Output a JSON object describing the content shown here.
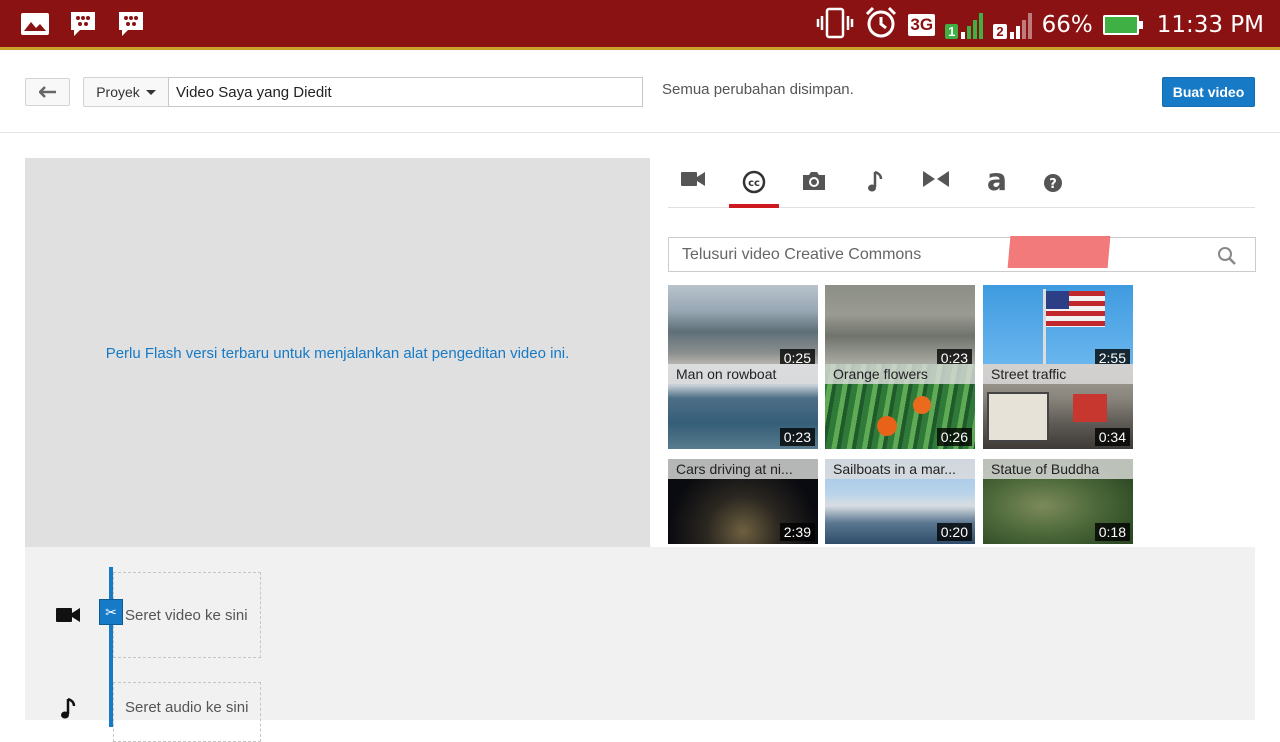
{
  "status_bar": {
    "network": "3G",
    "signal_1_label": "1",
    "signal_2_label": "2",
    "battery": "66%",
    "time": "11:33 PM",
    "icons": [
      "gallery-icon",
      "bbm-icon",
      "bbm-icon",
      "vibrate-icon",
      "alarm-icon",
      "signal-icon",
      "battery-icon"
    ]
  },
  "toolbar": {
    "project_label": "Proyek",
    "title_value": "Video Saya yang Diedit",
    "saved_status": "Semua perubahan disimpan.",
    "create_label": "Buat video"
  },
  "preview": {
    "message": "Perlu Flash versi terbaru untuk menjalankan alat pengeditan video ini."
  },
  "tabs": [
    {
      "icon": "video-camera-icon",
      "active": false
    },
    {
      "icon": "creative-commons-icon",
      "active": true
    },
    {
      "icon": "photo-camera-icon",
      "active": false
    },
    {
      "icon": "music-note-icon",
      "active": false
    },
    {
      "icon": "transitions-icon",
      "active": false
    },
    {
      "icon": "text-icon",
      "active": false
    },
    {
      "icon": "help-icon",
      "active": false
    }
  ],
  "search": {
    "placeholder": "Telusuri video Creative Commons"
  },
  "videos": [
    {
      "title": "",
      "duration": "0:25"
    },
    {
      "title": "",
      "duration": "0:23"
    },
    {
      "title": "",
      "duration": "2:55"
    },
    {
      "title": "Man on rowboat",
      "duration": "0:23"
    },
    {
      "title": "Orange flowers",
      "duration": "0:26"
    },
    {
      "title": "Street traffic",
      "duration": "0:34"
    },
    {
      "title": "Cars driving at ni...",
      "duration": "2:39"
    },
    {
      "title": "Sailboats in a mar...",
      "duration": "0:20"
    },
    {
      "title": "Statue of Buddha",
      "duration": "0:18"
    }
  ],
  "timeline": {
    "video_drop": "Seret video ke sini",
    "audio_drop": "Seret audio ke sini"
  },
  "colors": {
    "status_bar": "#8b1212",
    "accent_blue": "#167ac6",
    "active_tab": "#cc181e"
  }
}
